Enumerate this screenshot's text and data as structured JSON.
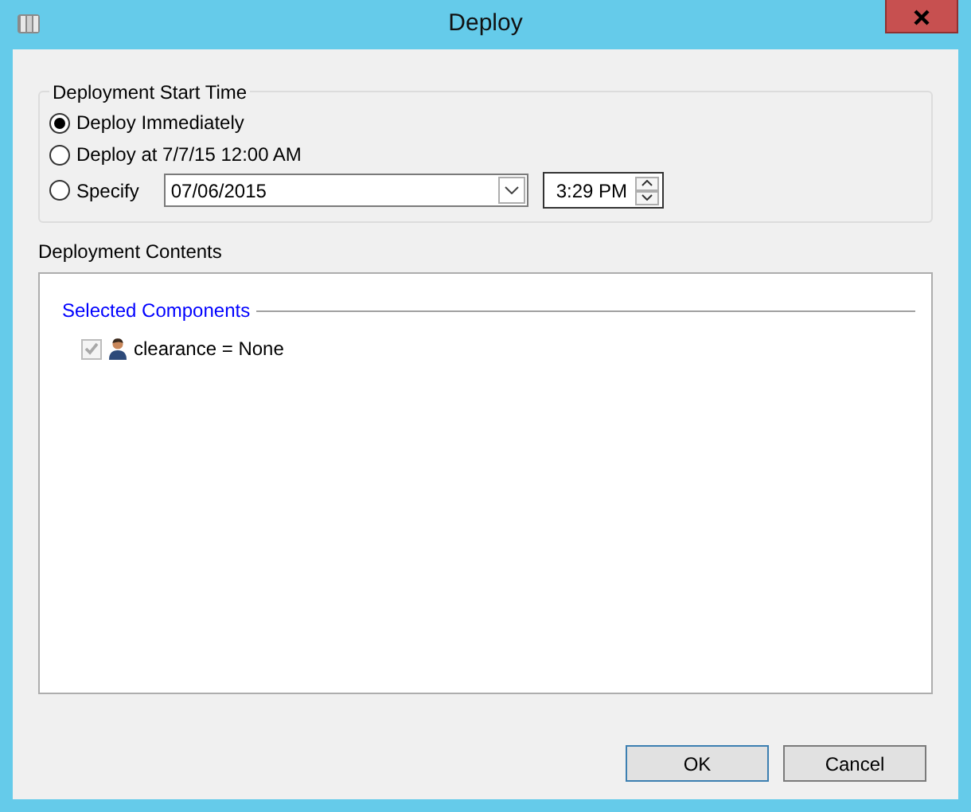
{
  "window": {
    "title": "Deploy"
  },
  "start_time": {
    "title": "Deployment Start Time",
    "options": [
      {
        "label": "Deploy Immediately",
        "selected": true,
        "kind": "plain"
      },
      {
        "label": "Deploy at 7/7/15 12:00 AM",
        "selected": false,
        "kind": "plain"
      },
      {
        "label": "Specify",
        "selected": false,
        "kind": "datetime",
        "date": "07/06/2015",
        "time": "3:29 PM"
      }
    ]
  },
  "contents": {
    "title": "Deployment Contents",
    "section": "Selected Components",
    "items": [
      {
        "label": "clearance = None",
        "checked": true,
        "disabled": true
      }
    ]
  },
  "buttons": [
    {
      "label": "OK",
      "default": true
    },
    {
      "label": "Cancel",
      "default": false
    }
  ]
}
